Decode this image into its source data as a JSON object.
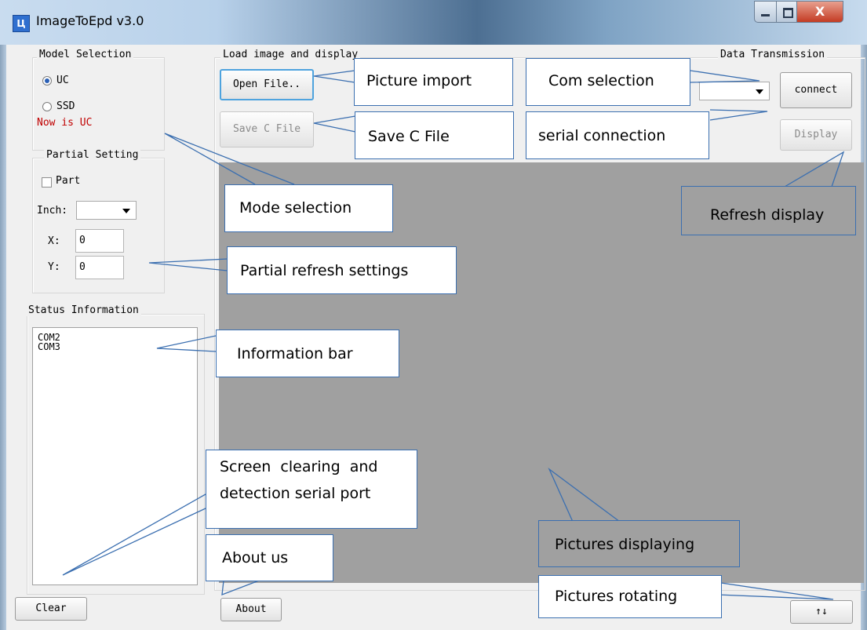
{
  "window": {
    "title": "ImageToEpd v3.0",
    "icon": "app-icon",
    "close_glyph": "X"
  },
  "model_selection": {
    "legend": "Model Selection",
    "options": [
      {
        "label": "UC",
        "selected": true
      },
      {
        "label": "SSD",
        "selected": false
      }
    ],
    "status": "Now is UC",
    "status_color": "#c00000"
  },
  "partial_setting": {
    "legend": "Partial Setting",
    "part_label": "Part",
    "part_checked": false,
    "inch_label": "Inch:",
    "inch_value": "",
    "x_label": "X:",
    "x_value": "0",
    "y_label": "Y:",
    "y_value": "0"
  },
  "status_info": {
    "legend": "Status Information",
    "lines": [
      "COM2",
      "COM3"
    ]
  },
  "load_image": {
    "legend": "Load image and display",
    "open_label": "Open File..",
    "save_label": "Save C File"
  },
  "data_transmission": {
    "legend": "Data Transmission",
    "com_value": "",
    "connect_label": "connect",
    "display_label": "Display"
  },
  "footer": {
    "clear_label": "Clear",
    "about_label": "About",
    "rotate_label": "↑↓"
  },
  "annotations": {
    "picture_import": "Picture import",
    "save_c_file": "Save C File",
    "com_selection": "Com selection",
    "serial_connection": "serial connection",
    "mode_selection": "Mode selection",
    "refresh_display": "Refresh display",
    "partial_refresh": "Partial refresh settings",
    "information_bar": "Information bar",
    "screen_clearing_1": "Screen  clearing  and",
    "screen_clearing_2": "detection serial port",
    "about_us": "About us",
    "pictures_displaying": "Pictures displaying",
    "pictures_rotating": "Pictures rotating"
  },
  "colors": {
    "callout_border": "#3b6fb0",
    "display_area": "#a0a0a0",
    "focus": "#4ea3de"
  }
}
